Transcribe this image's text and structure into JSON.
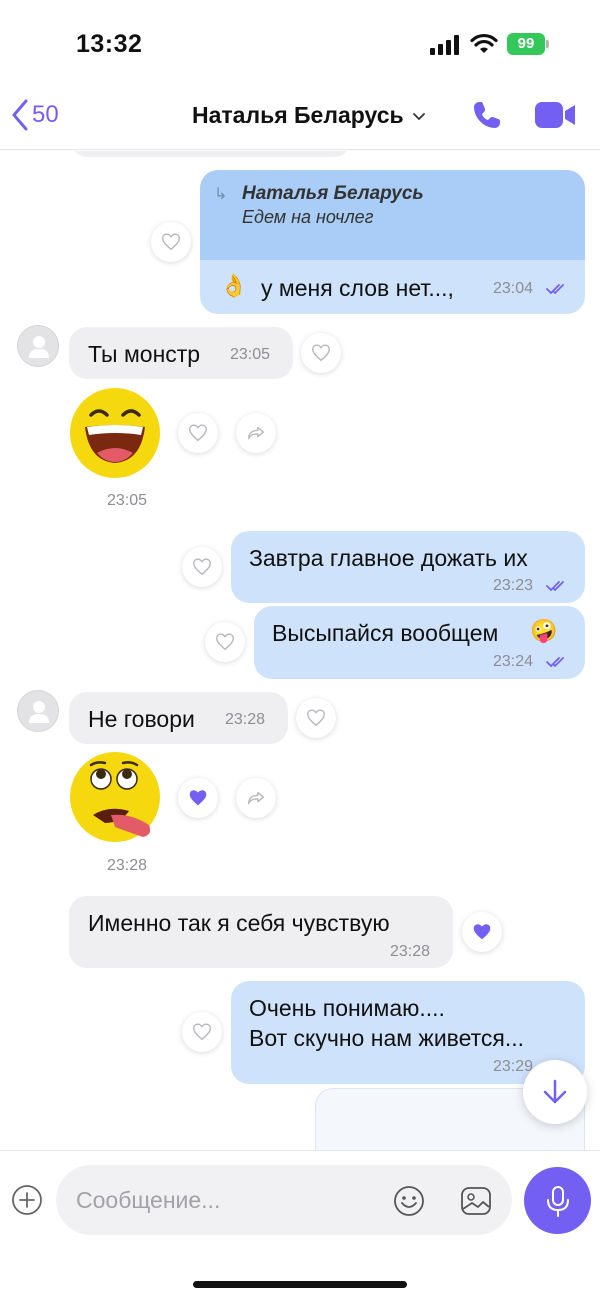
{
  "status_bar": {
    "time": "13:32",
    "battery": "99"
  },
  "header": {
    "back_count": "50",
    "contact_name": "Наталья Беларусь"
  },
  "colors": {
    "accent": "#7360f2",
    "incoming_bubble": "#efeff2",
    "outgoing_bubble": "#cfe2fb",
    "reply_block": "#a9cdf6",
    "battery": "#34c759"
  },
  "messages": [
    {
      "id": "m1",
      "direction": "out",
      "reply_to": {
        "name": "Наталья Беларусь",
        "text": "Едем на ночлег"
      },
      "emoji": "👌",
      "text": "у меня слов нет...,",
      "time": "23:04",
      "liked": false
    },
    {
      "id": "m2",
      "direction": "in",
      "text": "Ты монстр",
      "time": "23:05",
      "liked": false
    },
    {
      "id": "m3",
      "direction": "in",
      "sticker": "laughing-face-sticker",
      "time": "23:05",
      "liked": false
    },
    {
      "id": "m4",
      "direction": "out",
      "text": "Завтра главное дожать их",
      "time": "23:23",
      "liked": false
    },
    {
      "id": "m5",
      "direction": "out",
      "text": "Высыпайся вообщем",
      "emoji": "🤪",
      "time": "23:24",
      "liked": false
    },
    {
      "id": "m6",
      "direction": "in",
      "text": "Не говори",
      "time": "23:28",
      "liked": false
    },
    {
      "id": "m7",
      "direction": "in",
      "sticker": "exhausted-face-sticker",
      "time": "23:28",
      "liked": true
    },
    {
      "id": "m8",
      "direction": "in",
      "text": "Именно так я себя чувствую",
      "time": "23:28",
      "liked": true
    },
    {
      "id": "m9",
      "direction": "out",
      "lines": [
        "Очень понимаю....",
        "Вот скучно нам живется..."
      ],
      "time": "23:29",
      "liked": false
    }
  ],
  "composer": {
    "placeholder": "Сообщение..."
  },
  "icons": [
    "back-chevron-icon",
    "chevron-down-icon",
    "phone-icon",
    "video-camera-icon",
    "heart-icon",
    "share-icon",
    "arrow-down-icon",
    "plus-icon",
    "smiley-icon",
    "gallery-icon",
    "microphone-icon",
    "double-check-icon"
  ]
}
